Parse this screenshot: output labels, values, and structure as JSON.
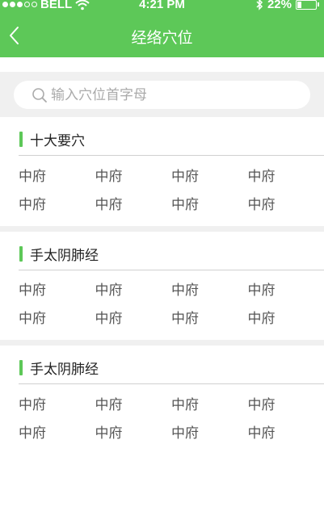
{
  "status_bar": {
    "carrier": "BELL",
    "time": "4:21 PM",
    "battery_percent": "22%",
    "battery_level": 0.22,
    "signal_dots_filled": 3,
    "signal_dots_total": 5,
    "icons": [
      "wifi-icon",
      "bluetooth-icon",
      "battery-icon"
    ]
  },
  "header": {
    "title": "经络穴位",
    "back_icon": "chevron-left-icon"
  },
  "search": {
    "placeholder": "输入穴位首字母",
    "value": "",
    "icon": "search-icon"
  },
  "sections": [
    {
      "title": "十大要穴",
      "rows": [
        [
          "中府",
          "中府",
          "中府",
          "中府"
        ],
        [
          "中府",
          "中府",
          "中府",
          "中府"
        ]
      ]
    },
    {
      "title": "手太阴肺经",
      "rows": [
        [
          "中府",
          "中府",
          "中府",
          "中府"
        ],
        [
          "中府",
          "中府",
          "中府",
          "中府"
        ]
      ]
    },
    {
      "title": "手太阴肺经",
      "rows": [
        [
          "中府",
          "中府",
          "中府",
          "中府"
        ],
        [
          "中府",
          "中府",
          "中府",
          "中府"
        ]
      ]
    }
  ],
  "colors": {
    "accent": "#5dc858",
    "background_gray": "#f0f0f0",
    "text_dark": "#222222",
    "text_item": "#555555"
  }
}
